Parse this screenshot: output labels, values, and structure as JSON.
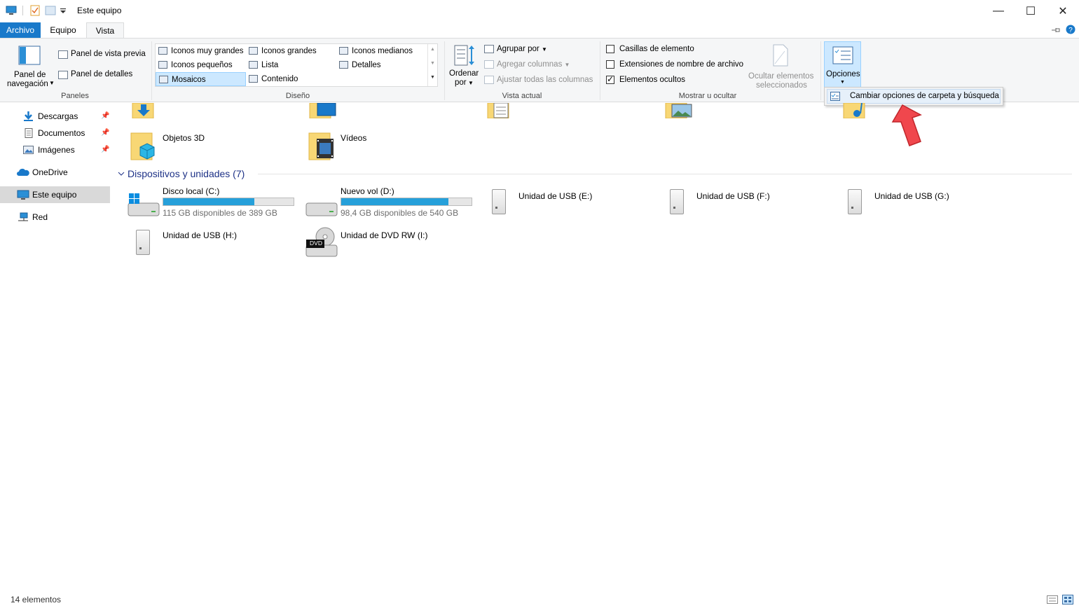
{
  "window": {
    "title": "Este equipo",
    "minimize": "—",
    "maximize": "☐",
    "close": "✕"
  },
  "ribbon_tabs": [
    "Archivo",
    "Equipo",
    "Vista"
  ],
  "ribbon": {
    "panels": {
      "nav_pane_label": "Panel de navegación",
      "nav_pane_line1": "Panel de",
      "nav_pane_line2": "navegación",
      "preview_pane": "Panel de vista previa",
      "details_pane": "Panel de detalles",
      "group_label": "Paneles"
    },
    "layout": {
      "items": [
        "Iconos muy grandes",
        "Iconos grandes",
        "Iconos medianos",
        "Iconos pequeños",
        "Lista",
        "Detalles",
        "Mosaicos",
        "Contenido"
      ],
      "selected": "Mosaicos",
      "group_label": "Diseño"
    },
    "current_view": {
      "sort_line1": "Ordenar",
      "sort_line2": "por",
      "group_by": "Agrupar por",
      "add_columns": "Agregar columnas",
      "fit_columns": "Ajustar todas las columnas",
      "group_label": "Vista actual"
    },
    "show_hide": {
      "item_checkboxes": {
        "label": "Casillas de elemento",
        "checked": false
      },
      "file_extensions": {
        "label": "Extensiones de nombre de archivo",
        "checked": false
      },
      "hidden_items": {
        "label": "Elementos ocultos",
        "checked": true
      },
      "hide_selected_line1": "Ocultar elementos",
      "hide_selected_line2": "seleccionados",
      "group_label": "Mostrar u ocultar"
    },
    "options": {
      "label": "Opciones",
      "menu_item": "Cambiar opciones de carpeta y búsqueda"
    }
  },
  "sidebar": {
    "items": [
      {
        "label": "Descargas",
        "pinned": true
      },
      {
        "label": "Documentos",
        "pinned": true
      },
      {
        "label": "Imágenes",
        "pinned": true
      },
      {
        "label": "OneDrive",
        "pinned": false
      },
      {
        "label": "Este equipo",
        "pinned": false,
        "selected": true
      },
      {
        "label": "Red",
        "pinned": false
      }
    ]
  },
  "folders": [
    {
      "name": "Objetos 3D"
    },
    {
      "name": "Vídeos"
    }
  ],
  "devices": {
    "header": "Dispositivos y unidades (7)",
    "drives": [
      {
        "name": "Disco local (C:)",
        "free": "115 GB disponibles de 389 GB",
        "used_fraction": 0.7
      },
      {
        "name": "Nuevo vol (D:)",
        "free": "98,4 GB disponibles de 540 GB",
        "used_fraction": 0.82
      },
      {
        "name": "Unidad de USB (E:)"
      },
      {
        "name": "Unidad de USB (F:)"
      },
      {
        "name": "Unidad de USB (G:)"
      },
      {
        "name": "Unidad de USB (H:)"
      },
      {
        "name": "Unidad de DVD RW (I:)",
        "badge": "DVD"
      }
    ]
  },
  "status_bar": {
    "count": "14 elementos"
  },
  "colors": {
    "accent": "#1979ca",
    "selection": "#cce8ff",
    "bar_fill": "#26a0da",
    "arrow": "#f0474d"
  }
}
